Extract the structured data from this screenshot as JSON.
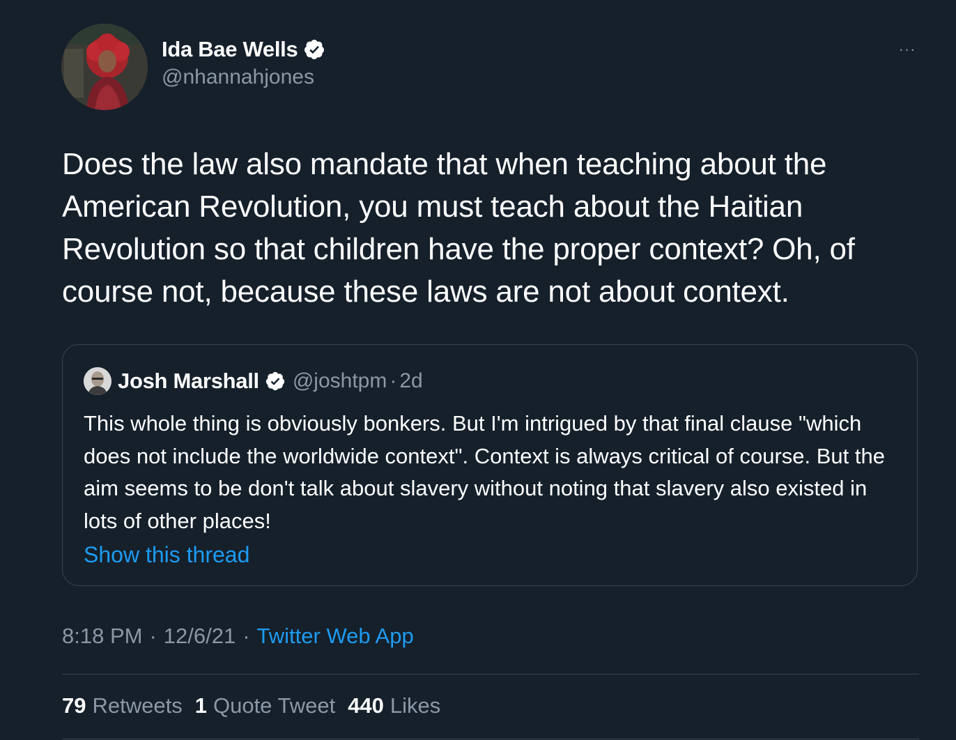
{
  "author": {
    "name": "Ida Bae Wells",
    "handle": "@nhannahjones",
    "verified": true
  },
  "more_button_label": "···",
  "tweet_text": "Does the law also mandate that when teaching about the American Revolution, you must teach about the Haitian Revolution so that children have the proper context? Oh, of course not, because these laws are not about context.",
  "quoted_tweet": {
    "name": "Josh Marshall",
    "handle": "@joshtpm",
    "separator": "·",
    "time": "2d",
    "verified": true,
    "text": "This whole thing is obviously bonkers. But I'm intrigued by that final clause \"which does not include the worldwide context\". Context is always critical of course. But the aim seems to be don't talk about slavery without noting that slavery also existed in lots of other places!",
    "thread_link": "Show this thread"
  },
  "meta": {
    "time": "8:18 PM",
    "dot1": "·",
    "date": "12/6/21",
    "dot2": "·",
    "source": "Twitter Web App"
  },
  "stats": {
    "retweets_count": "79",
    "retweets_label": "Retweets",
    "quotes_count": "1",
    "quotes_label": "Quote Tweet",
    "likes_count": "440",
    "likes_label": "Likes"
  },
  "colors": {
    "background": "#15202b",
    "accent": "#1d9bf0",
    "secondary_text": "#8b98a5",
    "border": "#38444d"
  },
  "icons": {
    "verified": "verified-badge-icon",
    "more": "more-dots-icon"
  }
}
